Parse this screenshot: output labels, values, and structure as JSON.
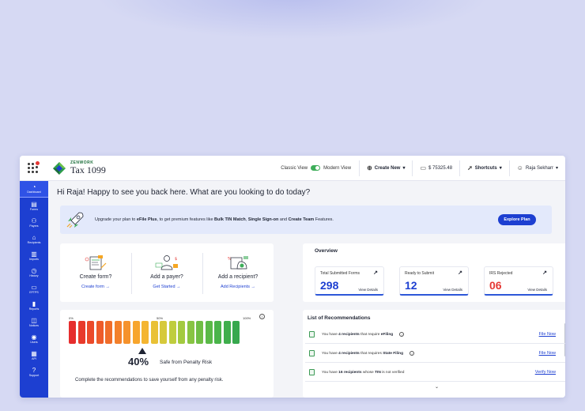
{
  "app": {
    "brand_top": "ZENWORK",
    "brand_main": "Tax 1099"
  },
  "topbar": {
    "classic_view": "Classic View",
    "modern_view": "Modern View",
    "create_new": "Create New",
    "balance": "$ 75325.48",
    "shortcuts": "Shortcuts",
    "user": "Raja Sekharr"
  },
  "sidebar": {
    "items": [
      {
        "label": "Dashboard",
        "icon": "dashboard-icon"
      },
      {
        "label": "Forms",
        "icon": "forms-icon"
      },
      {
        "label": "Payers",
        "icon": "payers-icon"
      },
      {
        "label": "Recipients",
        "icon": "recipients-icon"
      },
      {
        "label": "Imports",
        "icon": "imports-icon"
      },
      {
        "label": "History",
        "icon": "history-icon"
      },
      {
        "label": "EFTPS",
        "icon": "eftps-icon"
      },
      {
        "label": "Reports",
        "icon": "reports-icon"
      },
      {
        "label": "Notices",
        "icon": "notices-icon"
      },
      {
        "label": "Users",
        "icon": "users-icon"
      },
      {
        "label": "API",
        "icon": "api-icon"
      },
      {
        "label": "Support",
        "icon": "support-icon"
      }
    ]
  },
  "main": {
    "greeting": "Hi Raja! Happy to see you back here.  What are you looking to do today?",
    "upgrade": {
      "text_1": "Upgrade your plan to ",
      "plan": "eFile Plus",
      "text_2": ", to get premium features like ",
      "feature_1": "Bulk TIN Match",
      "sep_1": ", ",
      "feature_2": "Single Sign-on",
      "text_3": " and ",
      "feature_3": "Create Team",
      "text_4": " Features.",
      "button": "Explore Plan"
    },
    "actions": [
      {
        "title": "Create form?",
        "link": "Create form →"
      },
      {
        "title": "Add a payer?",
        "link": "Get Started →"
      },
      {
        "title": "Add a recipient?",
        "link": "Add Recipients →"
      }
    ],
    "overview": {
      "title": "Overview",
      "stats": [
        {
          "label": "Total Submitted Forms",
          "value": "298",
          "link": "View Details",
          "color": "#1d3fd1"
        },
        {
          "label": "Ready to Submit",
          "value": "12",
          "link": "View Details",
          "color": "#1d3fd1"
        },
        {
          "label": "IRS Rejected",
          "value": "06",
          "link": "View Details",
          "color": "#e53935"
        }
      ]
    },
    "risk": {
      "scale_min": "0%",
      "scale_mid": "50%",
      "scale_max": "100%",
      "percent": "40%",
      "percent_value": 40,
      "label": "Safe from Penalty Risk",
      "note": "Complete the recommendations to save yourself from any penalty risk."
    },
    "recommendations": {
      "title": "List of Recommendations",
      "items": [
        {
          "t1": "You have ",
          "count": "4 recipients",
          "t2": " that require ",
          "target": "eFiling",
          "t3": "",
          "link": "File Now",
          "info": true
        },
        {
          "t1": "You have ",
          "count": "4 recipients",
          "t2": " that requires ",
          "target": "State Filing",
          "t3": "",
          "link": "File Now",
          "info": true
        },
        {
          "t1": "You have ",
          "count": "16 recipients",
          "t2": " whose ",
          "target": "TIN",
          "t3": " is not verified",
          "link": "Verify Now",
          "info": false
        }
      ]
    }
  },
  "colors": {
    "primary": "#1d3fd1",
    "danger": "#e53935",
    "success": "#3fae5a"
  }
}
